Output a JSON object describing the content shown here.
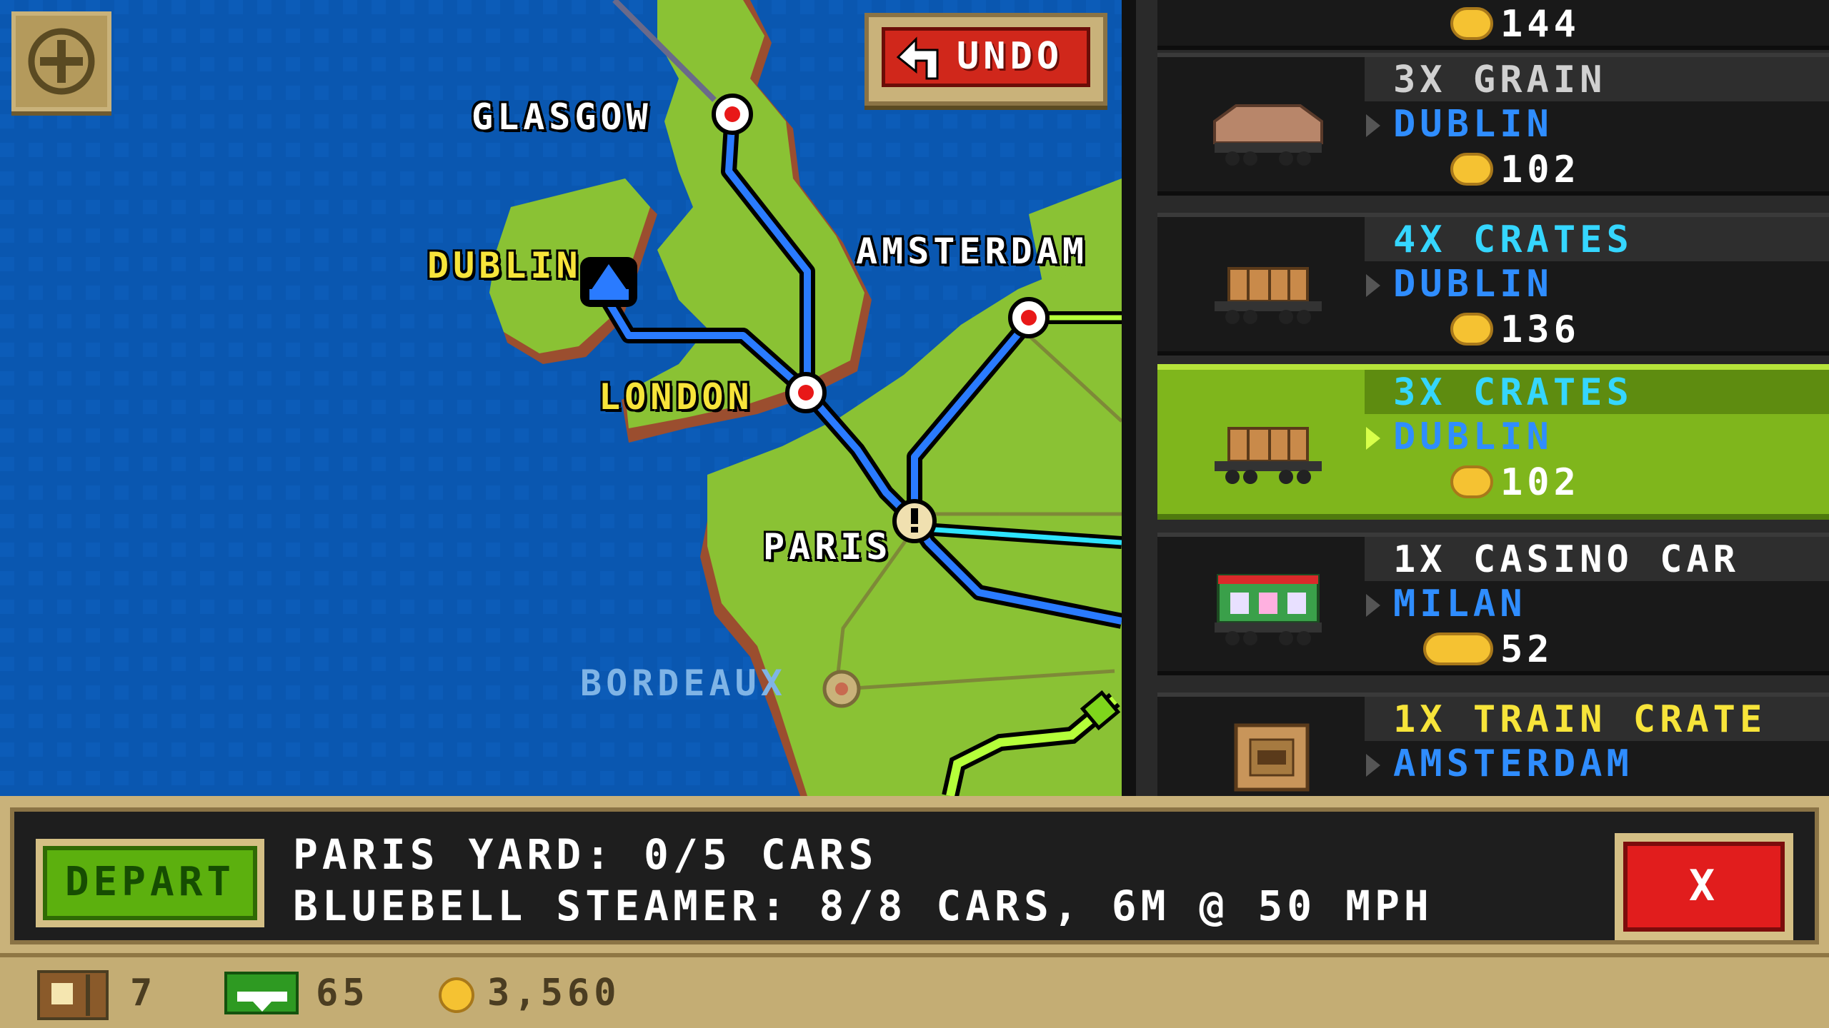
{
  "map": {
    "cities": [
      {
        "id": "glasgow",
        "name": "GLASGOW",
        "color": "#ffffff"
      },
      {
        "id": "dublin",
        "name": "DUBLIN",
        "color": "#f7e43a"
      },
      {
        "id": "amsterdam",
        "name": "AMSTERDAM",
        "color": "#ffffff"
      },
      {
        "id": "london",
        "name": "LONDON",
        "color": "#f7e43a"
      },
      {
        "id": "paris",
        "name": "PARIS",
        "color": "#ffffff"
      },
      {
        "id": "bordeaux",
        "name": "BORDEAUX",
        "color": "#7fb4e6"
      }
    ],
    "undo_label": "UNDO",
    "zoom_icon": "plus-icon"
  },
  "cargo": [
    {
      "qty": "",
      "dest": "",
      "price": "144",
      "qty_color": "#ffffff",
      "selected": false,
      "car": "hopper"
    },
    {
      "qty": "3X GRAIN",
      "dest": "DUBLIN",
      "price": "102",
      "qty_color": "#d0d0d0",
      "selected": false,
      "car": "hopper"
    },
    {
      "qty": "4X CRATES",
      "dest": "DUBLIN",
      "price": "136",
      "qty_color": "#35d6ff",
      "selected": false,
      "car": "crates"
    },
    {
      "qty": "3X CRATES",
      "dest": "DUBLIN",
      "price": "102",
      "qty_color": "#35d6ff",
      "selected": true,
      "car": "crates"
    },
    {
      "qty": "1X CASINO CAR",
      "dest": "MILAN",
      "price": "52",
      "qty_color": "#ffffff",
      "selected": false,
      "car": "casino"
    },
    {
      "qty": "1X TRAIN CRATE",
      "dest": "AMSTERDAM",
      "price": "",
      "qty_color": "#f7e43a",
      "selected": false,
      "car": "traincrate"
    }
  ],
  "bottom": {
    "depart_label": "DEPART",
    "yard_info": "PARIS YARD: 0/5 CARS",
    "train_info": "BLUEBELL STEAMER: 8/8 CARS, 6M @ 50 MPH",
    "close_label": "X"
  },
  "status": {
    "crates": "7",
    "cash": "65",
    "coins": "3,560"
  },
  "colors": {
    "ocean": "#0a57b0",
    "land": "#8ac234",
    "route_blue": "#2a7bff",
    "route_green": "#b5ff3a",
    "selected": "#7fb61c"
  }
}
